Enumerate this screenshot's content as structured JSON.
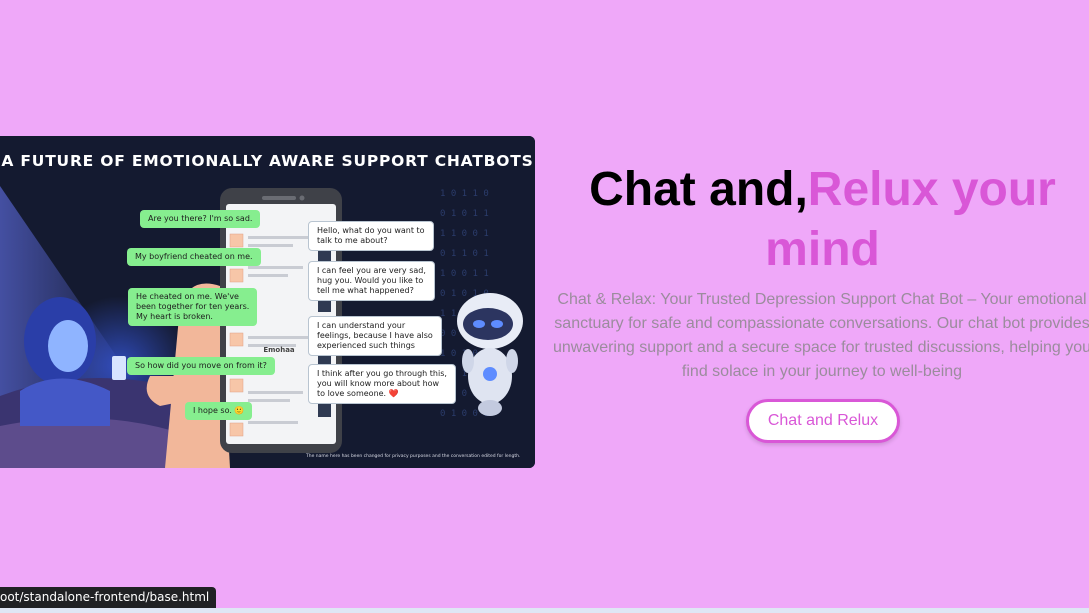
{
  "hero_image": {
    "title": "A FUTURE OF EMOTIONALLY AWARE SUPPORT CHATBOTS",
    "phone_header": "Emohaa",
    "user_messages": [
      "Are you there? I'm so sad.",
      "My boyfriend cheated on me.",
      "He cheated on me. We've\nbeen together for ten years.\nMy heart is broken.",
      "So how did you move on from it?",
      "I hope so. 🙂"
    ],
    "bot_messages": [
      "Hello, what do you want to\ntalk to me about?",
      "I can feel you are very sad,\nhug you. Would you like to\ntell me what happened?",
      "I can understand your\nfeelings, because I have also\nexperienced such things",
      "I think after you go through this,\nyou will know more about how\nto love someone. ❤️"
    ],
    "footnote": "The name here has been changed for privacy purposes and the conversation edited for length."
  },
  "hero": {
    "headline_part1": "Chat and,",
    "headline_part2": "Relux your mind",
    "description": "Chat & Relax: Your Trusted Depression Support Chat Bot – Your emotional sanctuary for safe and compassionate conversations. Our chat bot provides unwavering support and a secure space for trusted discussions, helping you find solace in your journey to well-being",
    "cta_label": "Chat and Relux"
  },
  "status_bar": {
    "url": "oot/standalone-frontend/base.html"
  },
  "colors": {
    "page_background": "#efa8f9",
    "accent_pink": "#d957d7",
    "headline_black": "#000000",
    "description_gray": "#9b8c9d"
  }
}
